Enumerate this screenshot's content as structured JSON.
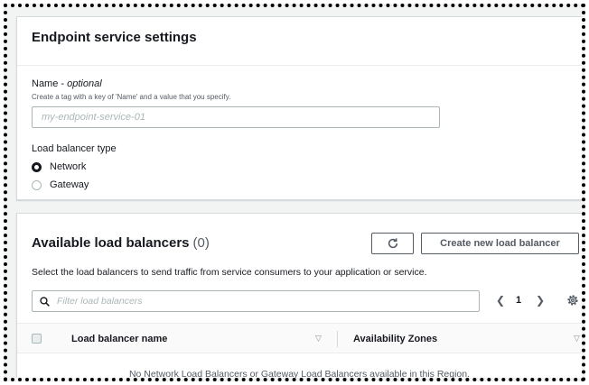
{
  "settings": {
    "title": "Endpoint service settings",
    "name_label": "Name - ",
    "name_optional": "optional",
    "name_description": "Create a tag with a key of 'Name' and a value that you specify.",
    "name_placeholder": "my-endpoint-service-01",
    "lb_type_label": "Load balancer type",
    "lb_type_options": [
      {
        "label": "Network",
        "selected": true
      },
      {
        "label": "Gateway",
        "selected": false
      }
    ]
  },
  "available": {
    "title": "Available load balancers",
    "count": "(0)",
    "create_button": "Create new load balancer",
    "description": "Select the load balancers to send traffic from service consumers to your application or service.",
    "filter_placeholder": "Filter load balancers",
    "page": "1",
    "columns": [
      "Load balancer name",
      "Availability Zones"
    ],
    "empty_message": "No Network Load Balancers or Gateway Load Balancers available in this Region."
  }
}
